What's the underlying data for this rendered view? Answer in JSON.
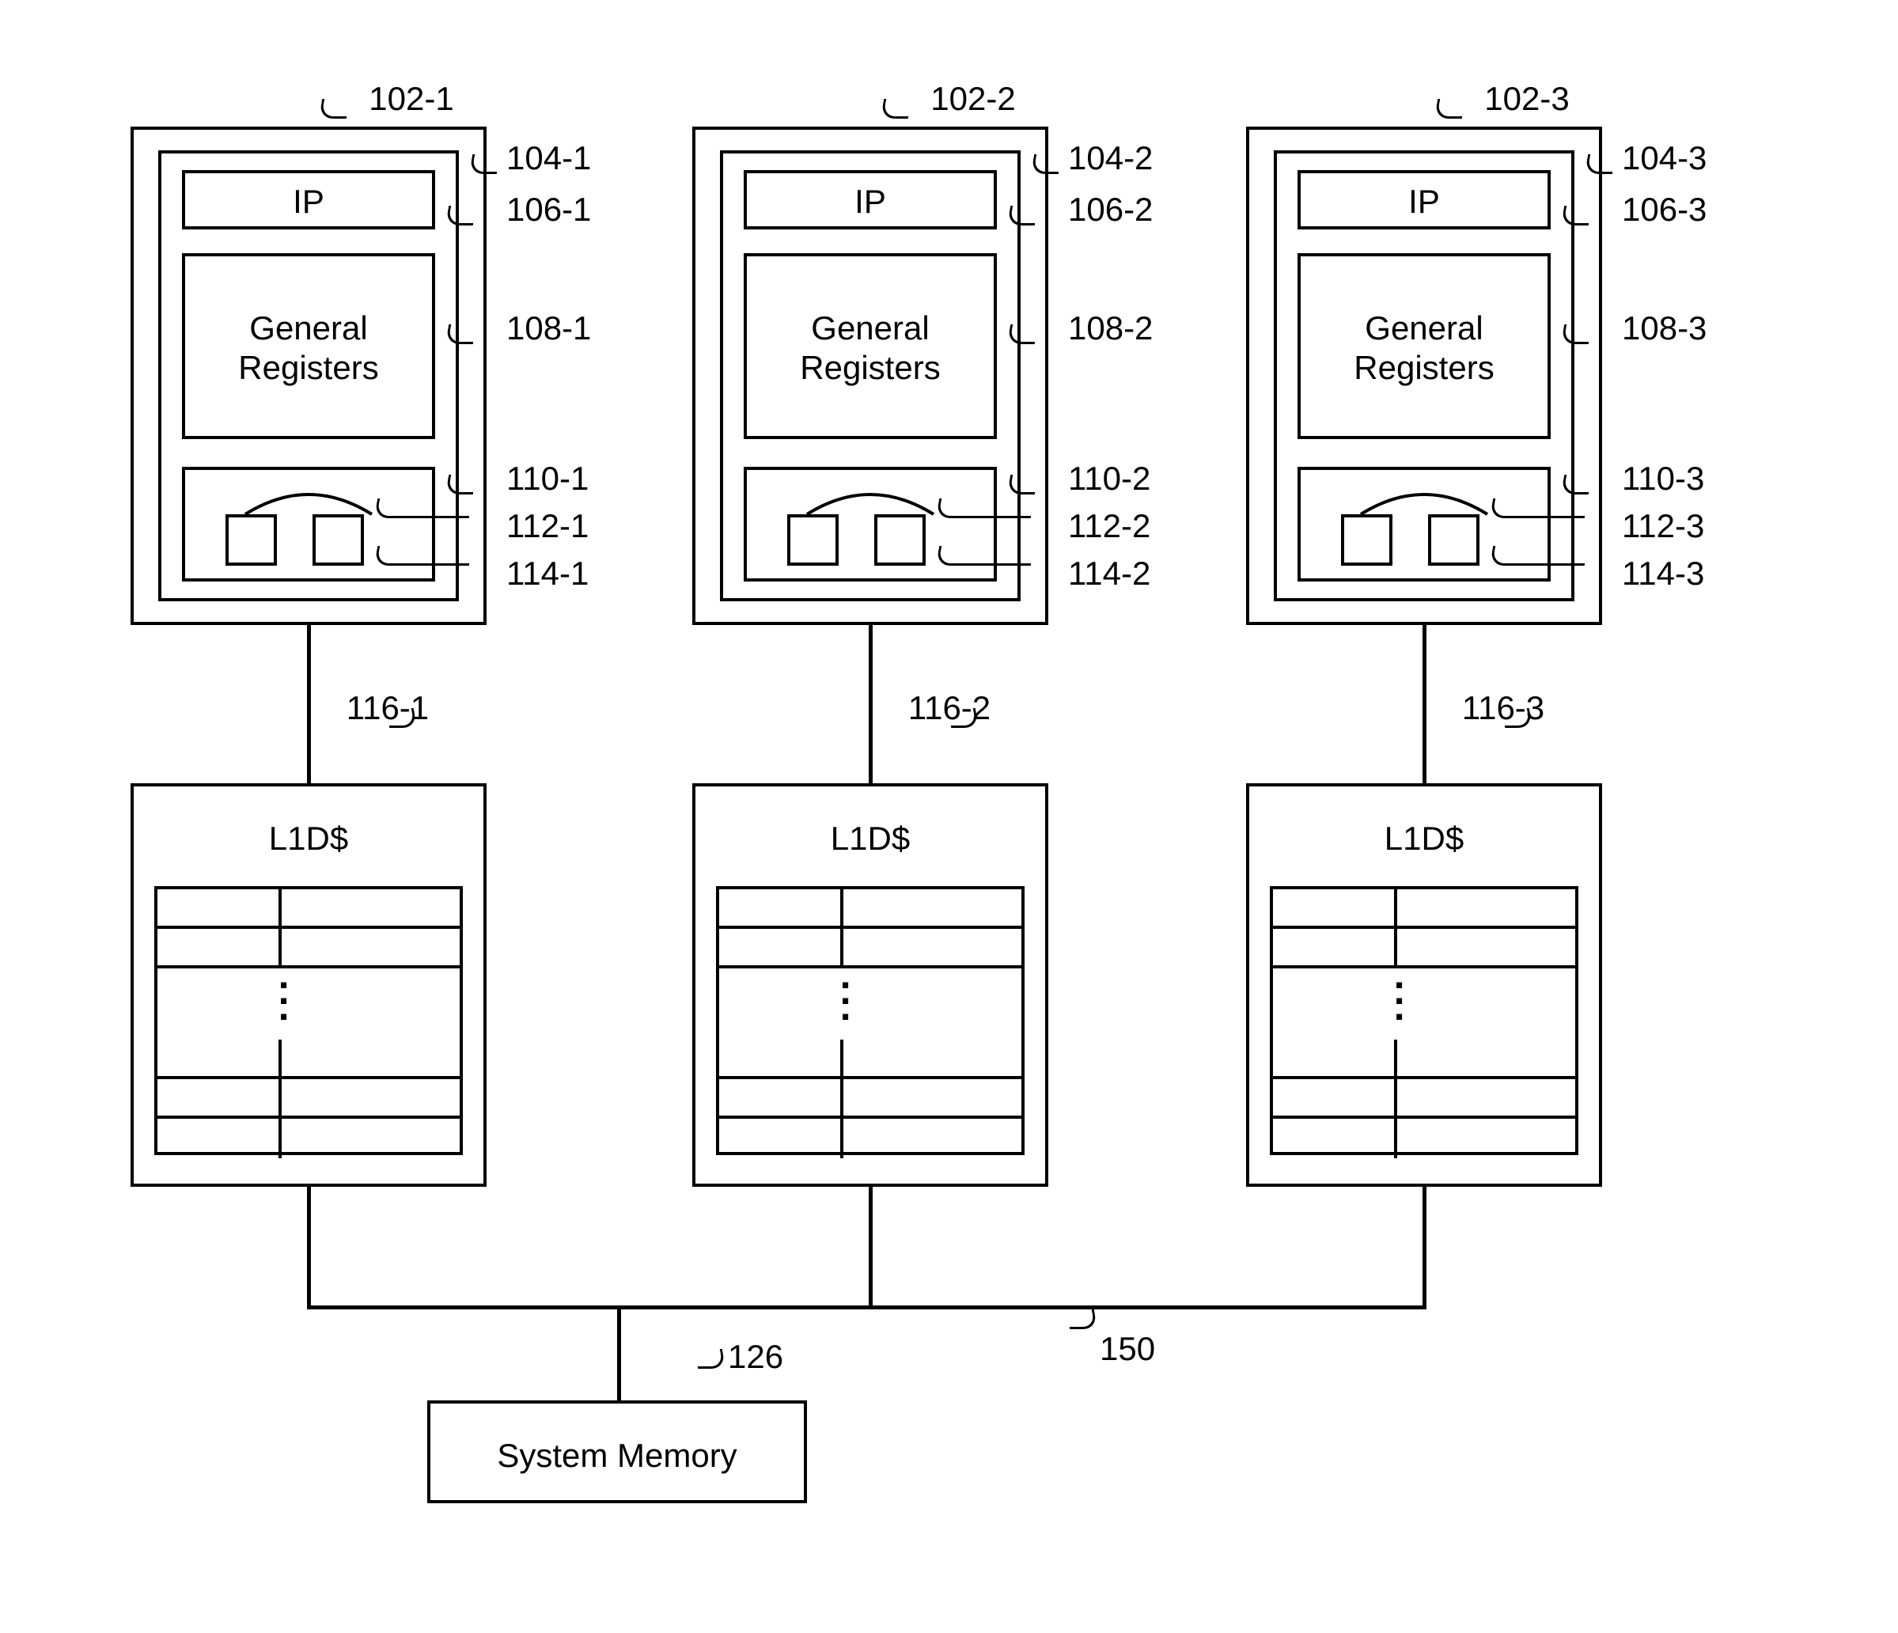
{
  "cpus": [
    {
      "id_label": "102-1",
      "ip_label": "IP",
      "ref_104": "104-1",
      "ref_106": "106-1",
      "gr_label": "General\nRegisters",
      "ref_108": "108-1",
      "ref_110": "110-1",
      "ref_112": "112-1",
      "ref_114": "114-1"
    },
    {
      "id_label": "102-2",
      "ip_label": "IP",
      "ref_104": "104-2",
      "ref_106": "106-2",
      "gr_label": "General\nRegisters",
      "ref_108": "108-2",
      "ref_110": "110-2",
      "ref_112": "112-2",
      "ref_114": "114-2"
    },
    {
      "id_label": "102-3",
      "ip_label": "IP",
      "ref_104": "104-3",
      "ref_106": "106-3",
      "gr_label": "General\nRegisters",
      "ref_108": "108-3",
      "ref_110": "110-3",
      "ref_112": "112-3",
      "ref_114": "114-3"
    }
  ],
  "caches": [
    {
      "label": "L1D$",
      "ref": "116-1"
    },
    {
      "label": "L1D$",
      "ref": "116-2"
    },
    {
      "label": "L1D$",
      "ref": "116-3"
    }
  ],
  "sysmem": {
    "label": "System Memory",
    "ref": "126"
  },
  "bus_ref": "150"
}
